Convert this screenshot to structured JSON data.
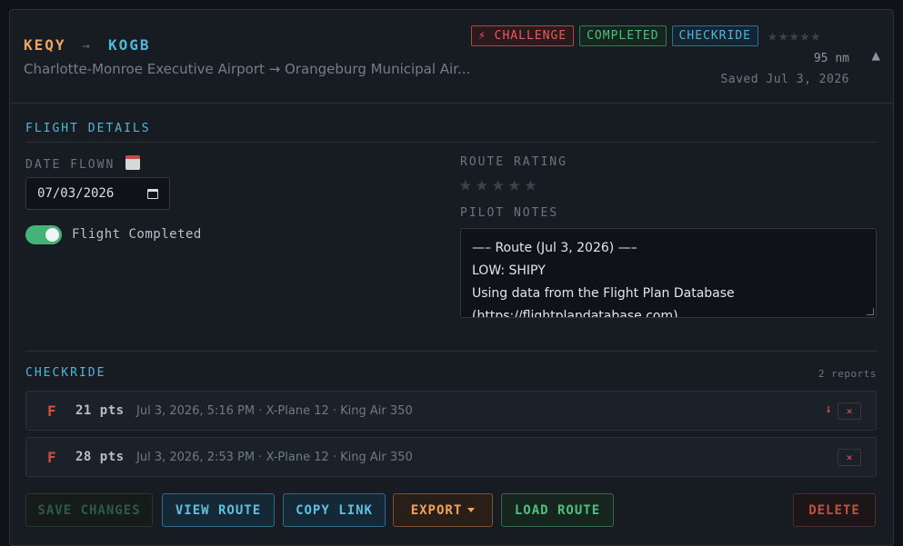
{
  "header": {
    "origin": "KEQY",
    "arrow": "→",
    "destination": "KOGB",
    "route_names": "Charlotte-Monroe Executive Airport → Orangeburg Municipal Air...",
    "badges": {
      "challenge": "⚡ CHALLENGE",
      "completed": "COMPLETED",
      "checkride": "CHECKRIDE"
    },
    "rating": 0,
    "distance": "95 nm",
    "saved": "Saved Jul 3, 2026"
  },
  "details": {
    "title": "FLIGHT DETAILS",
    "date_label": "DATE FLOWN",
    "date_value": "07/03/2026",
    "completed_label": "Flight Completed",
    "completed": true,
    "rating_label": "ROUTE RATING",
    "route_rating": 0,
    "notes_label": "PILOT NOTES",
    "notes_lines": [
      "—– Route (Jul 3, 2026) —–",
      "LOW: SHIPY",
      "Using data from the Flight Plan Database",
      "(https://flightplandatabase.com)"
    ]
  },
  "checkride": {
    "title": "CHECKRIDE",
    "count": "2 reports",
    "reports": [
      {
        "grade": "F",
        "points": "21 pts",
        "meta": "Jul 3, 2026, 5:16 PM · X-Plane 12 · King Air 350"
      },
      {
        "grade": "F",
        "points": "28 pts",
        "meta": "Jul 3, 2026, 2:53 PM · X-Plane 12 · King Air 350"
      }
    ]
  },
  "actions": {
    "save": "SAVE CHANGES",
    "view": "VIEW ROUTE",
    "copy": "COPY LINK",
    "export": "EXPORT",
    "load": "LOAD ROUTE",
    "delete": "DELETE"
  },
  "icons": {
    "calendar": "calendar-icon",
    "collapse": "chevron-up-icon",
    "download": "download-icon",
    "close": "close-icon",
    "star": "star-icon"
  },
  "colors": {
    "origin": "#f0a35e",
    "destination": "#4fb6d8",
    "fail_grade": "#d6503f",
    "toggle_on": "#43b377"
  }
}
